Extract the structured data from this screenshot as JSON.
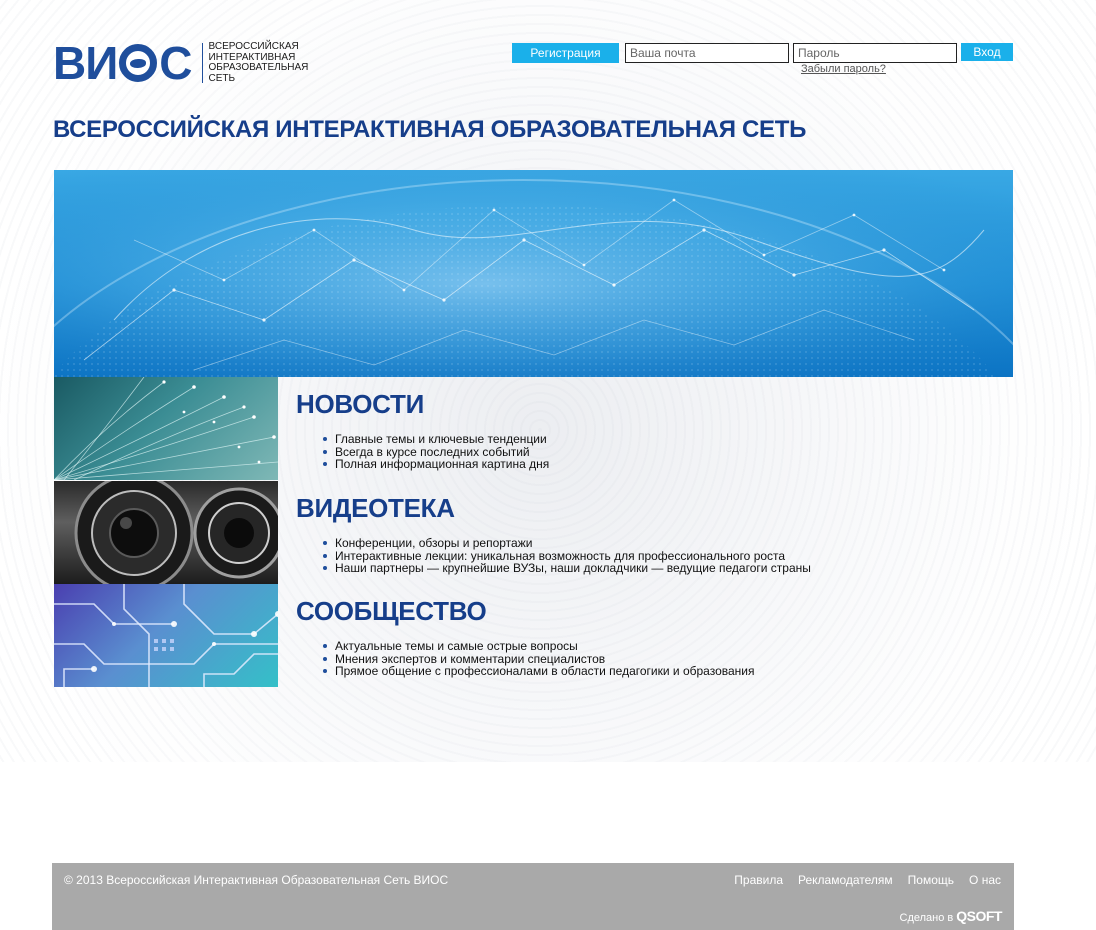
{
  "logo": {
    "mark": "ВИОС",
    "tagline": "ВСЕРОССИЙСКАЯ ИНТЕРАКТИВНАЯ ОБРАЗОВАТЕЛЬНАЯ СЕТЬ"
  },
  "auth": {
    "register_label": "Регистрация",
    "email_placeholder": "Ваша почта",
    "password_placeholder": "Пароль",
    "login_label": "Вход",
    "forgot_label": "Забыли пароль?"
  },
  "site_title": "ВСЕРОССИЙСКАЯ ИНТЕРАКТИВНАЯ ОБРАЗОВАТЕЛЬНАЯ СЕТЬ",
  "sections": [
    {
      "title": "НОВОСТИ",
      "items": [
        "Главные темы и ключевые тенденции",
        "Всегда в курсе последних событий",
        "Полная информационная картина дня"
      ]
    },
    {
      "title": "ВИДЕОТЕКА",
      "items": [
        "Конференции, обзоры и репортажи",
        "Интерактивные лекции: уникальная возможность для профессионального роста",
        "Наши партнеры — крупнейшие ВУЗы, наши докладчики — ведущие педагоги страны"
      ]
    },
    {
      "title": "СООБЩЕСТВО",
      "items": [
        "Актуальные темы и самые острые вопросы",
        "Мнения экспертов и комментарии специалистов",
        "Прямое общение с профессионалами в области педагогики и образования"
      ]
    }
  ],
  "footer": {
    "copyright": "© 2013 Всероссийская Интерактивная Образовательная Сеть ВИОС",
    "links": [
      "Правила",
      "Рекламодателям",
      "Помощь",
      "О нас"
    ],
    "made_by": "Сделано в",
    "made_by_brand": "QSOFT"
  },
  "colors": {
    "accent": "#1ab0ea",
    "title_blue": "#163e8a",
    "footer_bg": "#a9a9a9"
  },
  "icons": [
    "globe-logo-icon",
    "bullet-icon"
  ]
}
